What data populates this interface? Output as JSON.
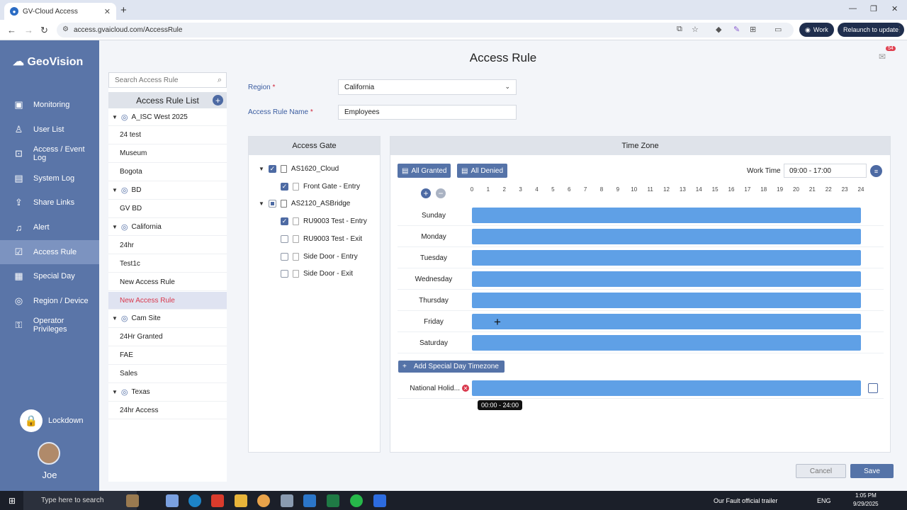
{
  "browser": {
    "tab_title": "GV-Cloud Access",
    "url": "access.gvaicloud.com/AccessRule",
    "profile": "Work",
    "relaunch": "Relaunch to update"
  },
  "sidebar": {
    "logo": "GeoVision",
    "items": [
      {
        "label": "Monitoring",
        "icon": "monitor-icon"
      },
      {
        "label": "User List",
        "icon": "user-icon"
      },
      {
        "label": "Access / Event Log",
        "icon": "log-icon"
      },
      {
        "label": "System Log",
        "icon": "system-log-icon"
      },
      {
        "label": "Share Links",
        "icon": "share-icon"
      },
      {
        "label": "Alert",
        "icon": "bell-icon"
      },
      {
        "label": "Access Rule",
        "icon": "rule-icon"
      },
      {
        "label": "Special Day",
        "icon": "calendar-icon"
      },
      {
        "label": "Region / Device",
        "icon": "pin-icon"
      },
      {
        "label": "Operator Privileges",
        "icon": "privileges-icon"
      }
    ],
    "active_index": 6,
    "lockdown": "Lockdown",
    "username": "Joe"
  },
  "page": {
    "title": "Access Rule",
    "notification_count": "54"
  },
  "rule_list": {
    "search_placeholder": "Search Access Rule",
    "header": "Access Rule List",
    "rows": [
      {
        "type": "group",
        "label": "A_ISC West 2025"
      },
      {
        "type": "leaf",
        "label": "24 test"
      },
      {
        "type": "leaf",
        "label": "Museum"
      },
      {
        "type": "leaf",
        "label": "Bogota"
      },
      {
        "type": "group",
        "label": "BD"
      },
      {
        "type": "leaf",
        "label": "GV BD"
      },
      {
        "type": "group",
        "label": "California"
      },
      {
        "type": "leaf",
        "label": "24hr"
      },
      {
        "type": "leaf",
        "label": "Test1c"
      },
      {
        "type": "leaf",
        "label": "New Access Rule"
      },
      {
        "type": "leaf",
        "label": "New Access Rule",
        "selected": true
      },
      {
        "type": "group",
        "label": "Cam Site"
      },
      {
        "type": "leaf",
        "label": "24Hr Granted"
      },
      {
        "type": "leaf",
        "label": "FAE"
      },
      {
        "type": "leaf",
        "label": "Sales"
      },
      {
        "type": "group",
        "label": "Texas"
      },
      {
        "type": "leaf",
        "label": "24hr Access"
      }
    ]
  },
  "form": {
    "region_label": "Region",
    "region_value": "California",
    "name_label": "Access Rule Name",
    "name_value": "Employees"
  },
  "gate": {
    "title": "Access Gate",
    "devices": [
      {
        "name": "AS1620_Cloud",
        "state": "checked",
        "doors": [
          {
            "name": "Front Gate - Entry",
            "checked": true
          }
        ]
      },
      {
        "name": "AS2120_ASBridge",
        "state": "partial",
        "doors": [
          {
            "name": "RU9003 Test - Entry",
            "checked": true
          },
          {
            "name": "RU9003 Test - Exit",
            "checked": false
          },
          {
            "name": "Side Door - Entry",
            "checked": false
          },
          {
            "name": "Side Door - Exit",
            "checked": false
          }
        ]
      }
    ]
  },
  "timezone": {
    "title": "Time Zone",
    "all_granted": "All Granted",
    "all_denied": "All Denied",
    "work_time_label": "Work Time",
    "work_time_value": "09:00 - 17:00",
    "hours": [
      "0",
      "1",
      "2",
      "3",
      "4",
      "5",
      "6",
      "7",
      "8",
      "9",
      "10",
      "11",
      "12",
      "13",
      "14",
      "15",
      "16",
      "17",
      "18",
      "19",
      "20",
      "21",
      "22",
      "23",
      "24"
    ],
    "days": [
      "Sunday",
      "Monday",
      "Tuesday",
      "Wednesday",
      "Thursday",
      "Friday",
      "Saturday"
    ],
    "schedule": [
      [
        0,
        24
      ],
      [
        0,
        24
      ],
      [
        0,
        24
      ],
      [
        0,
        24
      ],
      [
        0,
        24
      ],
      [
        0,
        24
      ],
      [
        0,
        24
      ]
    ],
    "add_special": "Add Special Day Timezone",
    "special_day": {
      "label": "National Holid...",
      "range": [
        0,
        24
      ]
    },
    "tooltip": "00:00 - 24:00",
    "bar_color": "#5fa0e6"
  },
  "footer": {
    "cancel": "Cancel",
    "save": "Save"
  },
  "taskbar": {
    "search": "Type here to search",
    "news": "Our Fault official trailer",
    "lang": "ENG",
    "time": "1:05 PM",
    "date": "9/29/2025"
  }
}
